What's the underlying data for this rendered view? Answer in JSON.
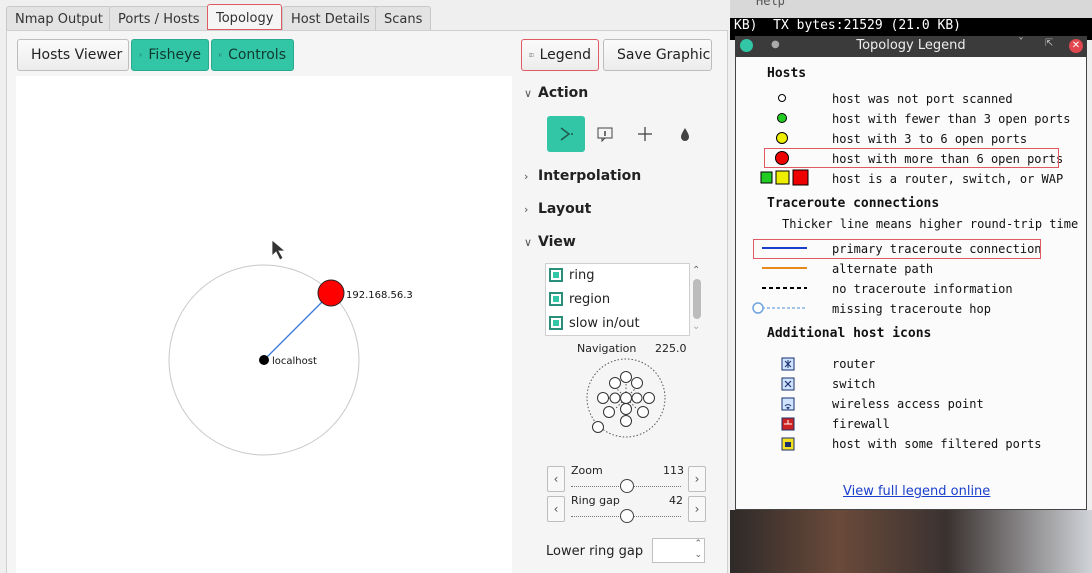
{
  "tabs": [
    {
      "label": "Nmap Output"
    },
    {
      "label": "Ports / Hosts"
    },
    {
      "label": "Topology"
    },
    {
      "label": "Host Details"
    },
    {
      "label": "Scans"
    }
  ],
  "toolbar": {
    "hosts_viewer": "Hosts Viewer",
    "fisheye": "Fisheye",
    "controls": "Controls",
    "legend": "Legend",
    "save_graphic": "Save Graphic"
  },
  "graph": {
    "nodes": [
      {
        "label": "192.168.56.3",
        "color": "#ff0000"
      },
      {
        "label": "localhost",
        "color": "#000000"
      }
    ]
  },
  "controls": {
    "action": "Action",
    "interpolation": "Interpolation",
    "layout": "Layout",
    "view": "View",
    "view_items": [
      "ring",
      "region",
      "slow in/out"
    ],
    "navigation_label": "Navigation",
    "navigation_value": "225.0",
    "zoom_label": "Zoom",
    "zoom_value": "113",
    "ring_gap_label": "Ring gap",
    "ring_gap_value": "42",
    "lower_ring_gap_label": "Lower ring gap",
    "accent_color": "#33c6a6"
  },
  "terminal": {
    "line": "KB)  TX bytes:21529 (21.0 KB)",
    "top_text": "Help"
  },
  "legend": {
    "title": "Topology Legend",
    "hosts_heading": "Hosts",
    "hosts": [
      "host was not port scanned",
      "host with fewer than 3 open ports",
      "host with 3 to 6 open ports",
      "host with more than 6 open ports",
      "host is a router, switch, or WAP"
    ],
    "traceroute_heading": "Traceroute connections",
    "traceroute_note": "Thicker line means higher round-trip time",
    "traceroute": [
      "primary traceroute connection",
      "alternate path",
      "no traceroute information",
      "missing traceroute hop"
    ],
    "icons_heading": "Additional host icons",
    "icons": [
      "router",
      "switch",
      "wireless access point",
      "firewall",
      "host with some filtered ports"
    ],
    "link": "View full legend online"
  }
}
